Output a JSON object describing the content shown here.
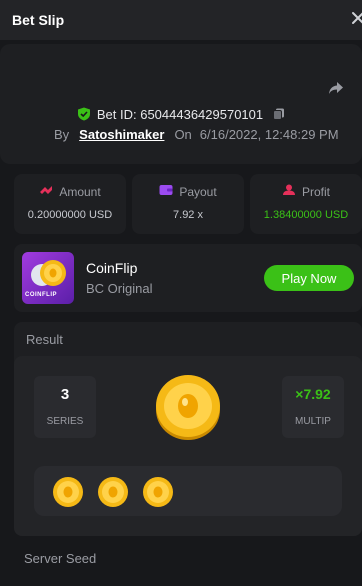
{
  "header": {
    "title": "Bet Slip"
  },
  "bet": {
    "id_label": "Bet ID: 65044436429570101",
    "by_label": "By",
    "user": "Satoshimaker",
    "on_label": "On",
    "datetime": "6/16/2022, 12:48:29 PM"
  },
  "stats": [
    {
      "label": "Amount",
      "value": "0.20000000 USD",
      "icon": "amount-icon"
    },
    {
      "label": "Payout",
      "value": "7.92 x",
      "icon": "wallet-icon"
    },
    {
      "label": "Profit",
      "value": "1.38400000 USD",
      "icon": "profit-icon"
    }
  ],
  "game": {
    "name": "CoinFlip",
    "subtitle": "BC Original",
    "thumb_text": "COINFLIP",
    "play_label": "Play Now"
  },
  "result": {
    "title": "Result",
    "series_value": "3",
    "series_label": "SERIES",
    "multip_value": "×7.92",
    "multip_label": "MULTIP",
    "history_count": 3
  },
  "server_seed": {
    "label": "Server Seed"
  },
  "colors": {
    "accent": "#3bc117",
    "background": "#17181b",
    "panel": "#1e1f22",
    "gold": "#f5b916"
  }
}
